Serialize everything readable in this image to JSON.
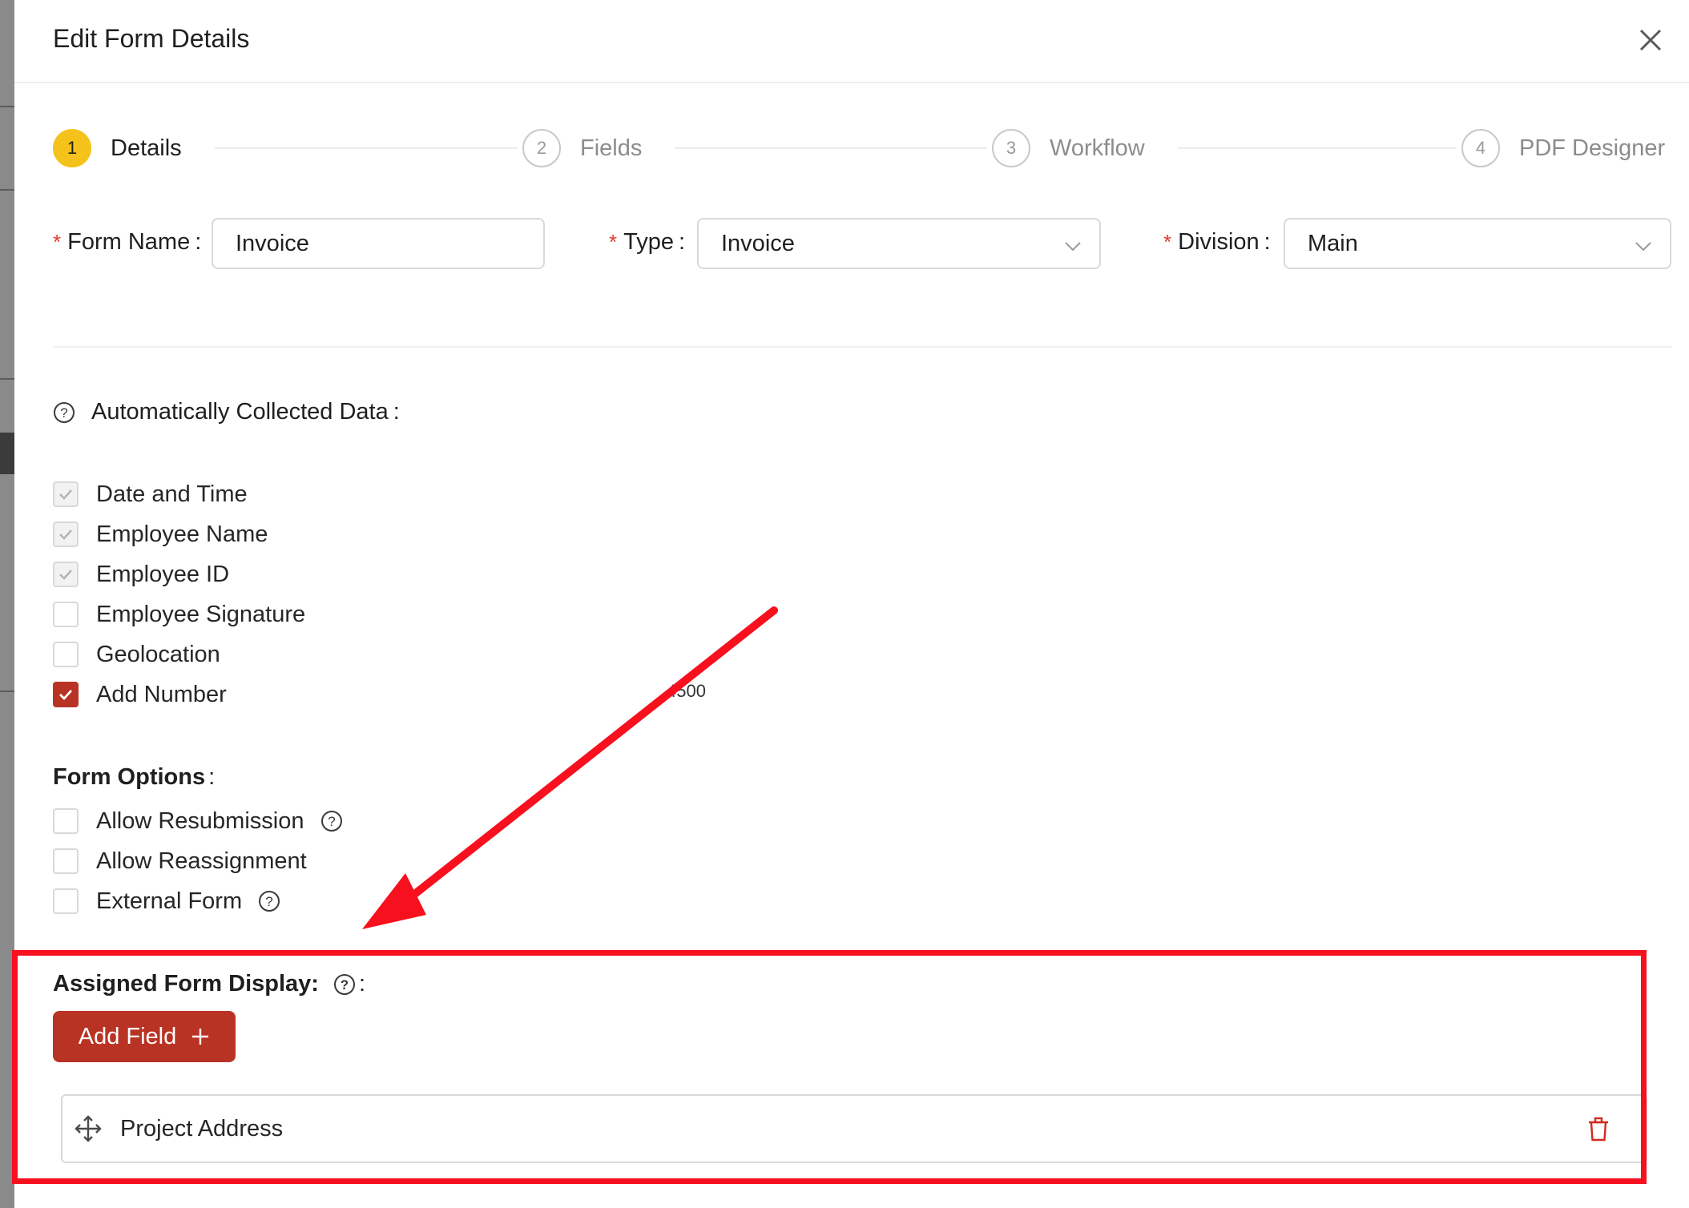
{
  "header": {
    "title": "Edit Form Details"
  },
  "steps": [
    {
      "number": "1",
      "label": "Details",
      "active": true
    },
    {
      "number": "2",
      "label": "Fields",
      "active": false
    },
    {
      "number": "3",
      "label": "Workflow",
      "active": false
    },
    {
      "number": "4",
      "label": "PDF Designer",
      "active": false
    }
  ],
  "form": {
    "required_mark": "*",
    "colon": ":",
    "form_name": {
      "label": "Form Name",
      "value": "Invoice"
    },
    "type": {
      "label": "Type",
      "value": "Invoice"
    },
    "division": {
      "label": "Division",
      "value": "Main"
    }
  },
  "auto_data": {
    "title": "Automatically Collected Data",
    "items": [
      {
        "label": "Date and Time",
        "checked": true,
        "disabled": true
      },
      {
        "label": "Employee Name",
        "checked": true,
        "disabled": true
      },
      {
        "label": "Employee ID",
        "checked": true,
        "disabled": true
      },
      {
        "label": "Employee Signature",
        "checked": false,
        "disabled": false
      },
      {
        "label": "Geolocation",
        "checked": false,
        "disabled": false
      },
      {
        "label": "Add Number",
        "checked": true,
        "disabled": false
      }
    ]
  },
  "stray_value": "4500",
  "form_options": {
    "title": "Form Options",
    "items": [
      {
        "label": "Allow Resubmission",
        "help": true
      },
      {
        "label": "Allow Reassignment",
        "help": false
      },
      {
        "label": "External Form",
        "help": true
      }
    ]
  },
  "assigned_display": {
    "title": "Assigned Form Display:",
    "add_button_label": "Add Field",
    "fields": [
      {
        "label": "Project Address"
      }
    ]
  },
  "colors": {
    "primary": "#b93324",
    "step_active": "#f4c21b",
    "annotation": "#f7101e",
    "required": "#e33b2f"
  }
}
